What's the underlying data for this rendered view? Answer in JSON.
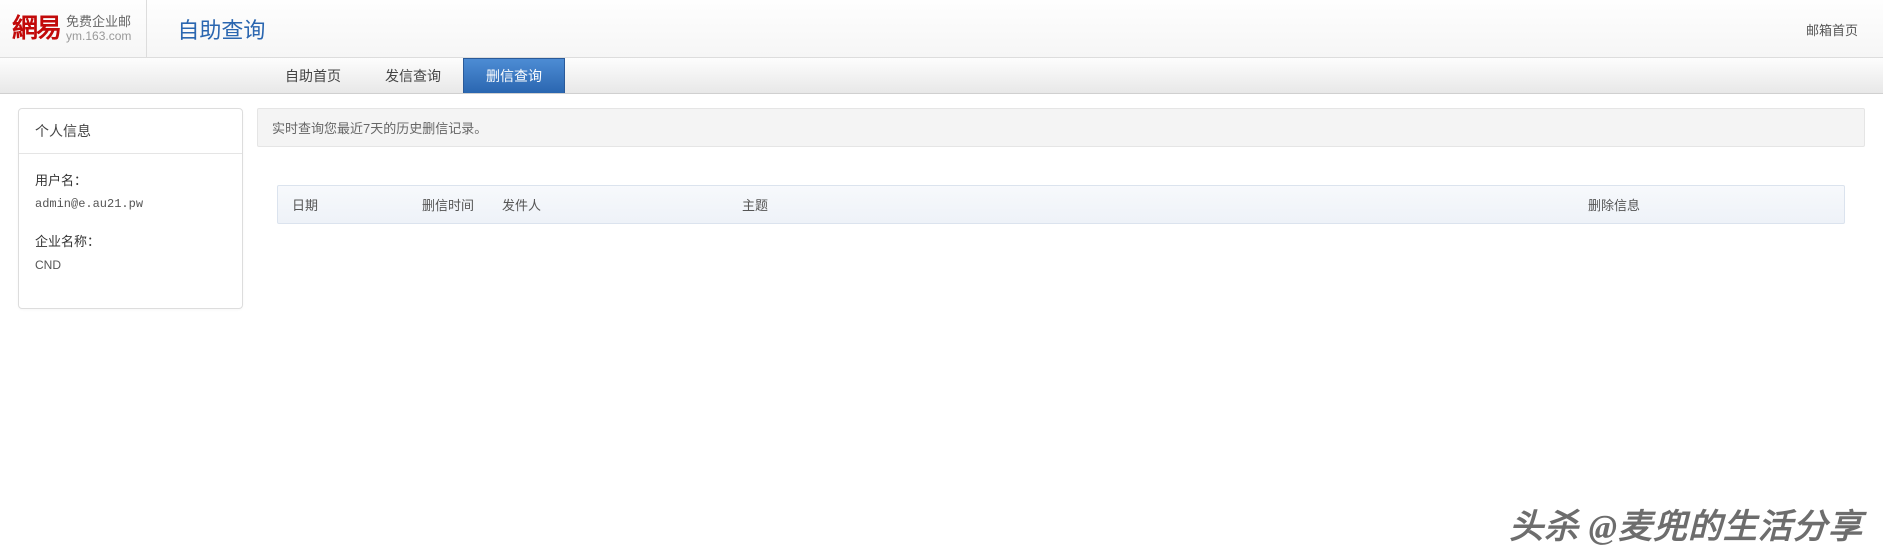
{
  "logo": {
    "chars": "網易",
    "sub_top": "免费企业邮",
    "sub_bottom": "ym.163.com"
  },
  "header": {
    "title": "自助查询",
    "mailbox_home": "邮箱首页"
  },
  "tabs": [
    {
      "label": "自助首页",
      "active": false
    },
    {
      "label": "发信查询",
      "active": false
    },
    {
      "label": "删信查询",
      "active": true
    }
  ],
  "sidebar": {
    "title": "个人信息",
    "username_label": "用户名：",
    "username_value": "admin@e.au21.pw",
    "company_label": "企业名称：",
    "company_value": "CND"
  },
  "main": {
    "info_text": "实时查询您最近7天的历史删信记录。",
    "columns": {
      "date": "日期",
      "delete_time": "删信时间",
      "sender": "发件人",
      "subject": "主题",
      "delete_info": "删除信息"
    }
  },
  "watermark": "头杀 @麦兜的生活分享"
}
